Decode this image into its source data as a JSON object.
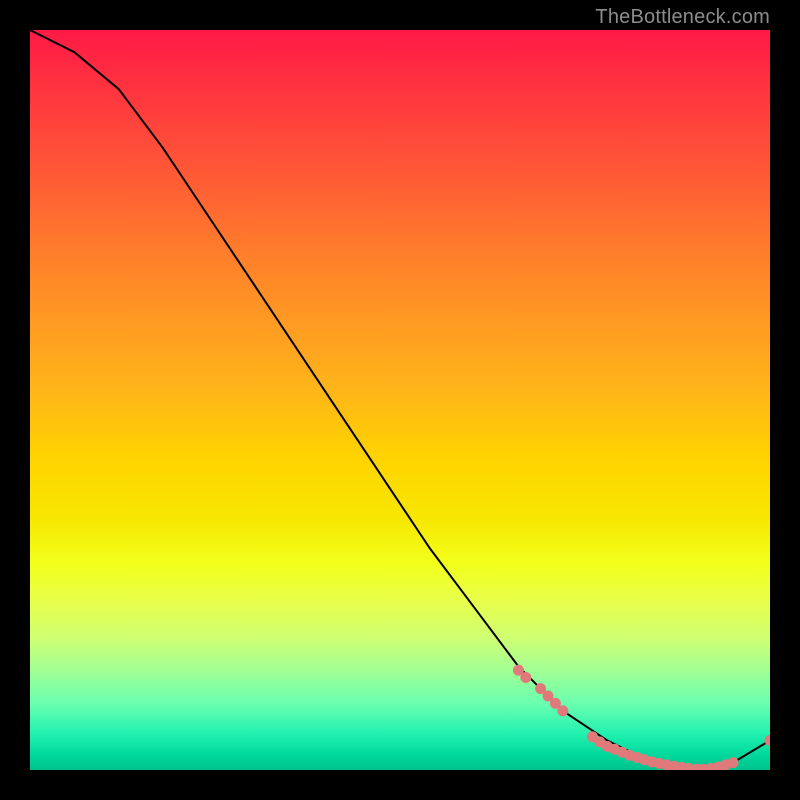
{
  "watermark": "TheBottleneck.com",
  "chart_data": {
    "type": "line",
    "title": "",
    "xlabel": "",
    "ylabel": "",
    "xlim": [
      0,
      100
    ],
    "ylim": [
      0,
      100
    ],
    "grid": false,
    "legend": false,
    "background": "red-yellow-green vertical gradient",
    "series": [
      {
        "name": "bottleneck-curve",
        "color": "#000000",
        "x": [
          0,
          6,
          12,
          18,
          24,
          30,
          36,
          42,
          48,
          54,
          60,
          66,
          72,
          78,
          84,
          90,
          95,
          100
        ],
        "y": [
          100,
          97,
          92,
          84,
          75,
          66,
          57,
          48,
          39,
          30,
          22,
          14,
          8,
          4,
          1,
          0,
          1,
          4
        ]
      }
    ],
    "markers": [
      {
        "name": "highlight-points",
        "color": "#e07a7a",
        "radius": 5.5,
        "x": [
          66,
          67,
          69,
          70,
          71,
          72,
          76,
          77,
          78,
          79,
          80,
          81,
          82,
          83,
          84,
          85,
          86,
          87,
          88,
          89,
          90,
          91,
          92,
          93,
          94,
          95,
          100
        ],
        "y": [
          13.5,
          12.5,
          11,
          10,
          9,
          8,
          4.5,
          3.8,
          3.2,
          2.8,
          2.4,
          2,
          1.7,
          1.4,
          1.1,
          0.9,
          0.7,
          0.5,
          0.35,
          0.2,
          0.1,
          0.1,
          0.2,
          0.4,
          0.7,
          1.0,
          4
        ]
      }
    ]
  }
}
